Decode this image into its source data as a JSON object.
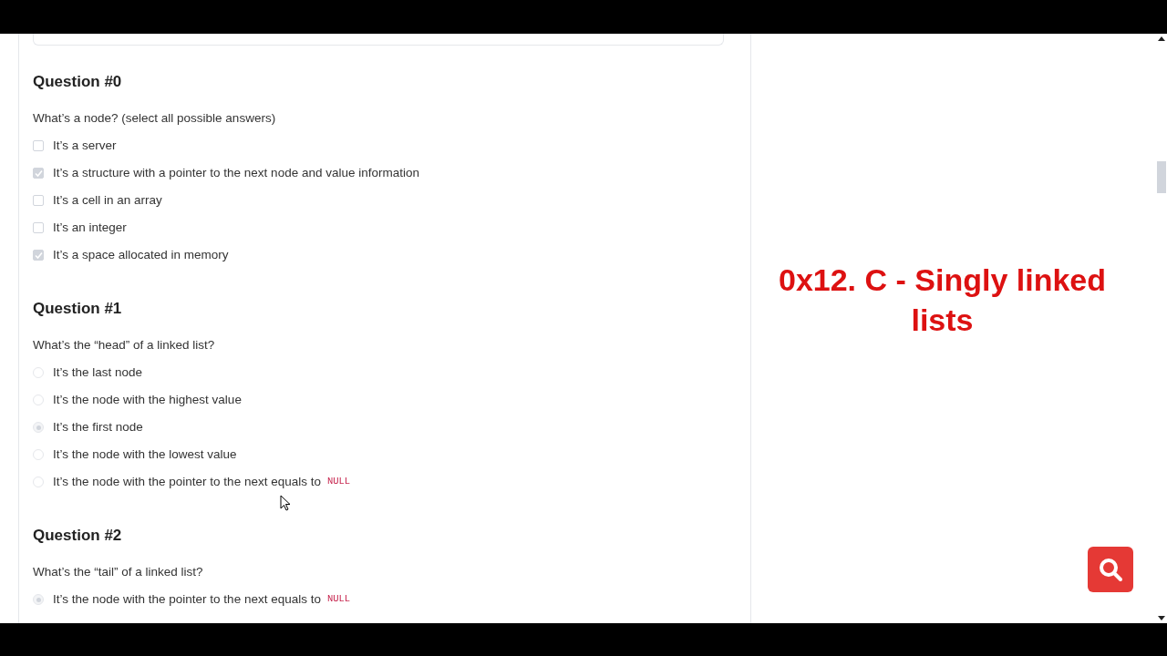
{
  "overlay_title": "0x12. C - Singly linked lists",
  "questions": [
    {
      "heading": "Question #0",
      "prompt": "What’s a node? (select all possible answers)",
      "kind": "checkbox",
      "options": [
        {
          "text": "It’s a server",
          "checked": false
        },
        {
          "text": "It’s a structure with a pointer to the next node and value information",
          "checked": true
        },
        {
          "text": "It’s a cell in an array",
          "checked": false
        },
        {
          "text": "It’s an integer",
          "checked": false
        },
        {
          "text": "It’s a space allocated in memory",
          "checked": true
        }
      ]
    },
    {
      "heading": "Question #1",
      "prompt": "What’s the “head” of a linked list?",
      "kind": "radio",
      "options": [
        {
          "text": "It’s the last node",
          "selected": false
        },
        {
          "text": "It’s the node with the highest value",
          "selected": false
        },
        {
          "text": "It’s the first node",
          "selected": true
        },
        {
          "text": "It’s the node with the lowest value",
          "selected": false
        },
        {
          "text": "It’s the node with the pointer to the next equals to",
          "code": "NULL",
          "selected": false
        }
      ]
    },
    {
      "heading": "Question #2",
      "prompt": "What’s the “tail” of a linked list?",
      "kind": "radio",
      "options": [
        {
          "text": "It’s the node with the pointer to the next equals to",
          "code": "NULL",
          "selected": true
        }
      ]
    }
  ]
}
